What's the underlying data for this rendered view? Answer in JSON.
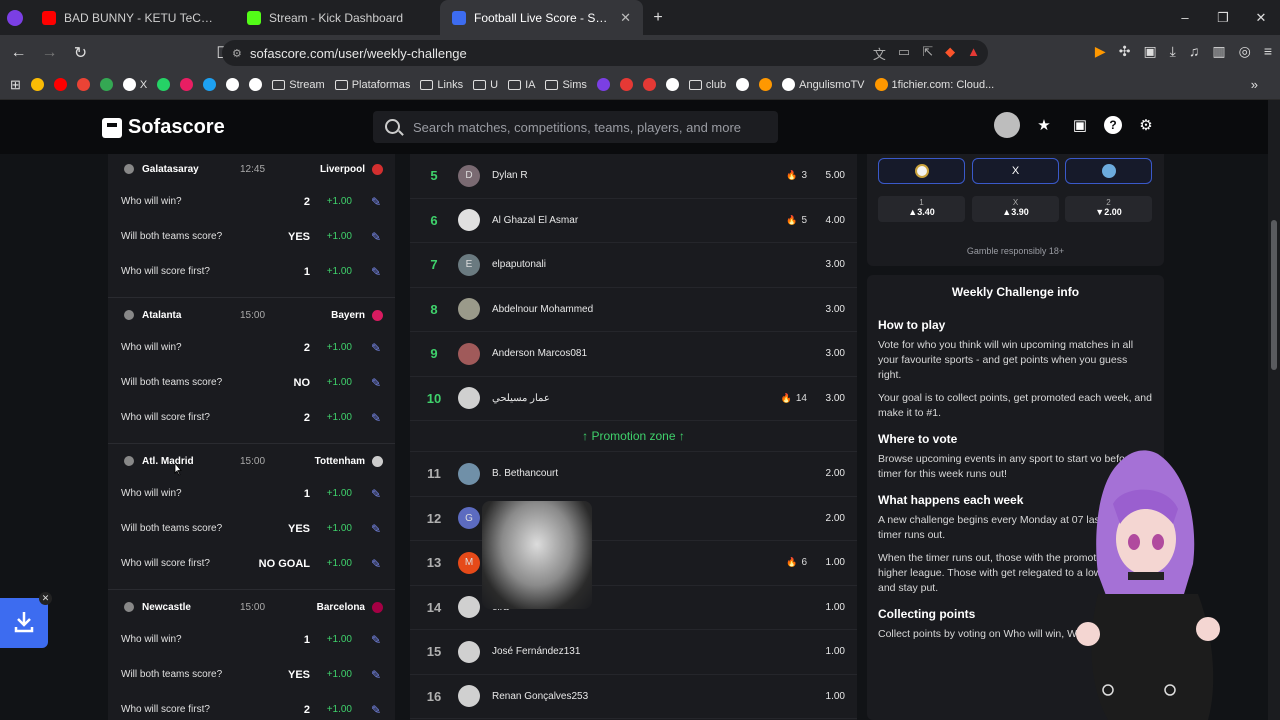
{
  "browser": {
    "tabs": [
      {
        "title": "BAD BUNNY - KETU TeCRÉ (Video",
        "favicon_color": "#ff0000",
        "active": false
      },
      {
        "title": "Stream - Kick Dashboard",
        "favicon_color": "#53fc18",
        "active": false
      },
      {
        "title": "Football Live Score - Sofascore",
        "favicon_color": "#3d6cf0",
        "active": true
      }
    ],
    "new_tab": "+",
    "window_controls": [
      "–",
      "❐",
      "✕"
    ],
    "url": "sofascore.com/user/weekly-challenge",
    "bookmarks": [
      {
        "label": "",
        "type": "icon",
        "color": "#fbbc05"
      },
      {
        "label": "",
        "type": "icon",
        "color": "#ff0000"
      },
      {
        "label": "",
        "type": "icon",
        "color": "#ea4335"
      },
      {
        "label": "",
        "type": "icon",
        "color": "#34a853"
      },
      {
        "label": "X",
        "type": "icon",
        "color": "#ffffff"
      },
      {
        "label": "",
        "type": "icon",
        "color": "#25d366"
      },
      {
        "label": "",
        "type": "icon",
        "color": "#e91e63"
      },
      {
        "label": "",
        "type": "icon",
        "color": "#1da1f2"
      },
      {
        "label": "",
        "type": "icon",
        "color": "#ffffff"
      },
      {
        "label": "",
        "type": "icon",
        "color": "#ffffff"
      },
      {
        "label": "Stream",
        "type": "folder"
      },
      {
        "label": "Plataformas",
        "type": "folder"
      },
      {
        "label": "Links",
        "type": "folder"
      },
      {
        "label": "U",
        "type": "folder"
      },
      {
        "label": "IA",
        "type": "folder"
      },
      {
        "label": "Sims",
        "type": "folder"
      },
      {
        "label": "",
        "type": "icon",
        "color": "#7b3fe4"
      },
      {
        "label": "",
        "type": "icon",
        "color": "#e53935"
      },
      {
        "label": "",
        "type": "icon",
        "color": "#e53935"
      },
      {
        "label": "",
        "type": "icon",
        "color": "#ffffff"
      },
      {
        "label": "club",
        "type": "folder"
      },
      {
        "label": "",
        "type": "icon",
        "color": "#ffffff"
      },
      {
        "label": "",
        "type": "icon",
        "color": "#ff9800"
      },
      {
        "label": "AngulismoTV",
        "type": "icon",
        "color": "#ffffff"
      },
      {
        "label": "1fichier.com: Cloud...",
        "type": "icon",
        "color": "#ff9800"
      }
    ]
  },
  "site": {
    "logo": "Sofascore",
    "search_placeholder": "Search matches, competitions, teams, players, and more"
  },
  "matches": [
    {
      "home": "Galatasaray",
      "time": "12:45",
      "away": "Liverpool",
      "crest_color": "#d32f2f",
      "questions": [
        {
          "q": "Who will win?",
          "a": "2",
          "pts": "+1.00"
        },
        {
          "q": "Will both teams score?",
          "a": "YES",
          "pts": "+1.00"
        },
        {
          "q": "Who will score first?",
          "a": "1",
          "pts": "+1.00"
        }
      ]
    },
    {
      "home": "Atalanta",
      "time": "15:00",
      "away": "Bayern",
      "crest_color": "#d81b60",
      "questions": [
        {
          "q": "Who will win?",
          "a": "2",
          "pts": "+1.00"
        },
        {
          "q": "Will both teams score?",
          "a": "NO",
          "pts": "+1.00"
        },
        {
          "q": "Who will score first?",
          "a": "2",
          "pts": "+1.00"
        }
      ]
    },
    {
      "home": "Atl. Madrid",
      "time": "15:00",
      "away": "Tottenham",
      "crest_color": "#cccccc",
      "questions": [
        {
          "q": "Who will win?",
          "a": "1",
          "pts": "+1.00"
        },
        {
          "q": "Will both teams score?",
          "a": "YES",
          "pts": "+1.00"
        },
        {
          "q": "Who will score first?",
          "a": "NO GOAL",
          "pts": "+1.00"
        }
      ]
    },
    {
      "home": "Newcastle",
      "time": "15:00",
      "away": "Barcelona",
      "crest_color": "#a50044",
      "questions": [
        {
          "q": "Who will win?",
          "a": "1",
          "pts": "+1.00"
        },
        {
          "q": "Will both teams score?",
          "a": "YES",
          "pts": "+1.00"
        },
        {
          "q": "Who will score first?",
          "a": "2",
          "pts": "+1.00"
        }
      ]
    }
  ],
  "leaderboard": {
    "rows_top": [
      {
        "rank": "5",
        "initial": "D",
        "name": "Dylan R",
        "fires": "3",
        "score": "5.00",
        "av_color": "#7a6a72"
      },
      {
        "rank": "6",
        "initial": "",
        "name": "Al Ghazal El Asmar",
        "fires": "5",
        "score": "4.00",
        "av_color": "#e0e0e0"
      },
      {
        "rank": "7",
        "initial": "E",
        "name": "elpaputonali",
        "fires": "",
        "score": "3.00",
        "av_color": "#6a7a80"
      },
      {
        "rank": "8",
        "initial": "",
        "name": "Abdelnour Mohammed",
        "fires": "",
        "score": "3.00",
        "av_color": "#9a9a8a"
      },
      {
        "rank": "9",
        "initial": "",
        "name": "Anderson Marcos081",
        "fires": "",
        "score": "3.00",
        "av_color": "#a05a5a"
      },
      {
        "rank": "10",
        "initial": "",
        "name": "عمار مسيلحي",
        "fires": "14",
        "score": "3.00",
        "av_color": "#d0d0d0"
      }
    ],
    "promotion_label": "↑ Promotion zone ↑",
    "rows_bottom": [
      {
        "rank": "11",
        "initial": "",
        "name": "B. Bethancourt",
        "fires": "",
        "score": "2.00",
        "av_color": "#7090a8"
      },
      {
        "rank": "12",
        "initial": "G",
        "name": "",
        "fires": "",
        "score": "2.00",
        "av_color": "#5c6bc0"
      },
      {
        "rank": "13",
        "initial": "M",
        "name": "",
        "fires": "6",
        "score": "1.00",
        "av_color": "#e64a19"
      },
      {
        "rank": "14",
        "initial": "",
        "name": "eira",
        "fires": "",
        "score": "1.00",
        "av_color": "#d0d0d0"
      },
      {
        "rank": "15",
        "initial": "",
        "name": "José Fernández131",
        "fires": "",
        "score": "1.00",
        "av_color": "#d0d0d0"
      },
      {
        "rank": "16",
        "initial": "",
        "name": "Renan Gonçalves253",
        "fires": "",
        "score": "1.00",
        "av_color": "#d0d0d0"
      }
    ]
  },
  "odds": {
    "buttons": [
      {
        "label": ""
      },
      {
        "label": "X"
      },
      {
        "label": ""
      }
    ],
    "values": [
      {
        "key": "1",
        "val": "▲3.40"
      },
      {
        "key": "X",
        "val": "▲3.90"
      },
      {
        "key": "2",
        "val": "▼2.00"
      }
    ],
    "gamble": "Gamble responsibly 18+"
  },
  "info": {
    "title": "Weekly Challenge info",
    "sections": [
      {
        "h": "How to play",
        "p": [
          "Vote for who you think will win upcoming matches in all your favourite sports - and get points when you guess right.",
          "Your goal is to collect points, get promoted each week, and make it to #1."
        ]
      },
      {
        "h": "Where to vote",
        "p": [
          "Browse upcoming events in any sport to start vo before the timer for this week runs out!"
        ]
      },
      {
        "h": "What happens each week",
        "p": [
          "A new challenge begins every Monday at 07 lasts until the timer runs out.",
          "When the timer runs out, those with the promoted to a higher league. Those with get relegated to a lower league, and stay put."
        ]
      },
      {
        "h": "Collecting points",
        "p": [
          "Collect points by voting on Who will win, Wi"
        ]
      }
    ]
  }
}
